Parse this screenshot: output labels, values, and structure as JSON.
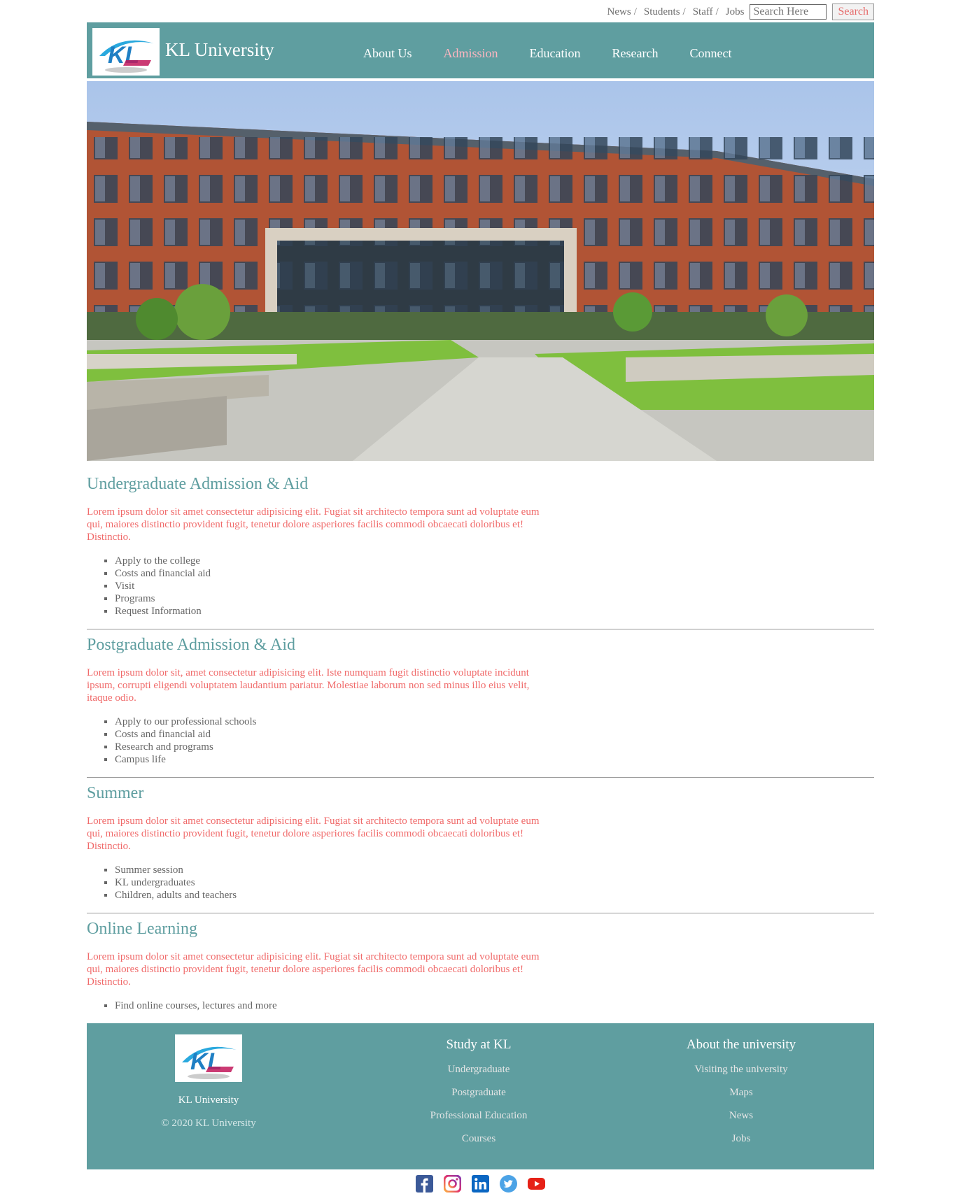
{
  "topbar": {
    "links": [
      "News",
      "Students",
      "Staff",
      "Jobs"
    ],
    "search_placeholder": "Search Here",
    "search_button": "Search"
  },
  "header": {
    "brand": "KL University",
    "logo_text": "KL",
    "nav": [
      "About Us",
      "Admission",
      "Education",
      "Research",
      "Connect"
    ],
    "active_nav": "Admission"
  },
  "sections": [
    {
      "title": "Undergraduate Admission & Aid",
      "text": "Lorem ipsum dolor sit amet consectetur adipisicing elit. Fugiat sit architecto tempora sunt ad voluptate eum qui, maiores distinctio provident fugit, tenetur dolore asperiores facilis commodi obcaecati doloribus et! Distinctio.",
      "items": [
        "Apply to the college",
        "Costs and financial aid",
        "Visit",
        "Programs",
        "Request Information"
      ]
    },
    {
      "title": "Postgraduate Admission & Aid",
      "text": "Lorem ipsum dolor sit, amet consectetur adipisicing elit. Iste numquam fugit distinctio voluptate incidunt ipsum, corrupti eligendi voluptatem laudantium pariatur. Molestiae laborum non sed minus illo eius velit, itaque odio.",
      "items": [
        "Apply to our professional schools",
        "Costs and financial aid",
        "Research and programs",
        "Campus life"
      ]
    },
    {
      "title": "Summer",
      "text": "Lorem ipsum dolor sit amet consectetur adipisicing elit. Fugiat sit architecto tempora sunt ad voluptate eum qui, maiores distinctio provident fugit, tenetur dolore asperiores facilis commodi obcaecati doloribus et! Distinctio.",
      "items": [
        "Summer session",
        "KL undergraduates",
        "Children, adults and teachers"
      ]
    },
    {
      "title": "Online Learning",
      "text": "Lorem ipsum dolor sit amet consectetur adipisicing elit. Fugiat sit architecto tempora sunt ad voluptate eum qui, maiores distinctio provident fugit, tenetur dolore asperiores facilis commodi obcaecati doloribus et! Distinctio.",
      "items": [
        "Find online courses, lectures and more"
      ]
    }
  ],
  "footer": {
    "brand": "KL University",
    "copyright": "© 2020 KL University",
    "col1_title": "Study at KL",
    "col1_links": [
      "Undergraduate",
      "Postgraduate",
      "Professional Education",
      "Courses"
    ],
    "col2_title": "About the university",
    "col2_links": [
      "Visiting the university",
      "Maps",
      "News",
      "Jobs"
    ]
  },
  "social": [
    "facebook-icon",
    "instagram-icon",
    "linkedin-icon",
    "twitter-icon",
    "youtube-icon"
  ],
  "colors": {
    "primary": "#5f9ea0",
    "accent": "#f06a6a",
    "active_nav": "#ffb6c1"
  }
}
